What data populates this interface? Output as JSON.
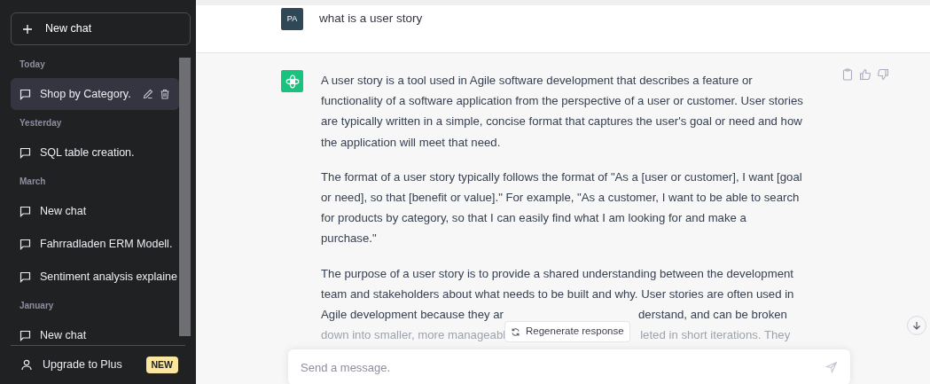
{
  "sidebar": {
    "new_chat": {
      "label": "New chat"
    },
    "groups": [
      {
        "label": "Today",
        "items": [
          {
            "title": "Shop by Category.",
            "selected": true
          }
        ]
      },
      {
        "label": "Yesterday",
        "items": [
          {
            "title": "SQL table creation.",
            "selected": false
          }
        ]
      },
      {
        "label": "March",
        "items": [
          {
            "title": "New chat",
            "selected": false
          },
          {
            "title": "Fahrradladen ERM Modell.",
            "selected": false
          },
          {
            "title": "Sentiment analysis explaine",
            "selected": false
          }
        ]
      },
      {
        "label": "January",
        "items": [
          {
            "title": "New chat",
            "selected": false
          }
        ]
      }
    ],
    "upgrade": {
      "label": "Upgrade to Plus",
      "badge": "NEW"
    }
  },
  "user_message": {
    "avatar": "PA",
    "text": "what is a user story"
  },
  "assistant_message": {
    "paragraphs": [
      "A user story is a tool used in Agile software development that describes a feature or functionality of a software application from the perspective of a user or customer. User stories are typically written in a simple, concise format that captures the user's goal or need and how the application will meet that need.",
      "The format of a user story typically follows the format of \"As a [user or customer], I want [goal or need], so that [benefit or value].\" For example, \"As a customer, I want to be able to search for products by category, so that I can easily find what I am looking for and make a purchase.\""
    ],
    "lines": [
      "The purpose of a user story is to provide a shared understanding between the development",
      "team and stakeholders about what needs to be built and why. User stories are often used in"
    ],
    "covered_lines": [
      {
        "left": "Agile development because they ar",
        "right": "derstand, and can be broken"
      },
      {
        "left": "down into smaller, more manageabl",
        "right": "leted in short iterations. They"
      }
    ]
  },
  "regenerate": {
    "label": "Regenerate response"
  },
  "composer": {
    "placeholder": "Send a message."
  }
}
